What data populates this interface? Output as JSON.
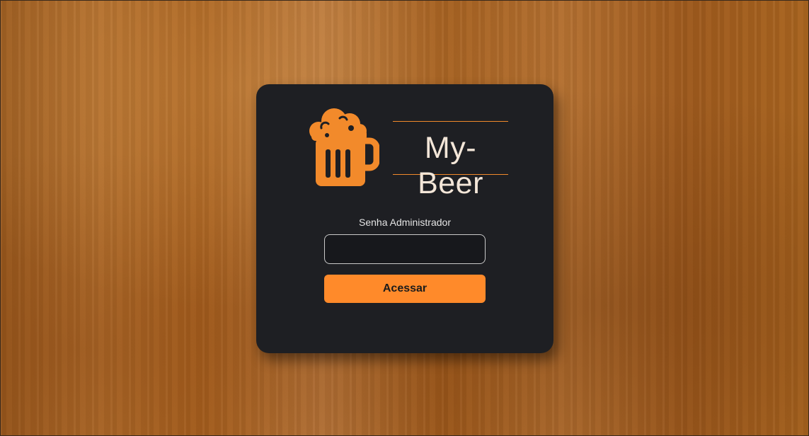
{
  "brand": {
    "title": "My-Beer",
    "logo_icon": "beer-mug-icon",
    "accent_color": "#ff8a2a"
  },
  "login": {
    "password_label": "Senha Administrador",
    "password_value": "",
    "submit_label": "Acessar"
  }
}
